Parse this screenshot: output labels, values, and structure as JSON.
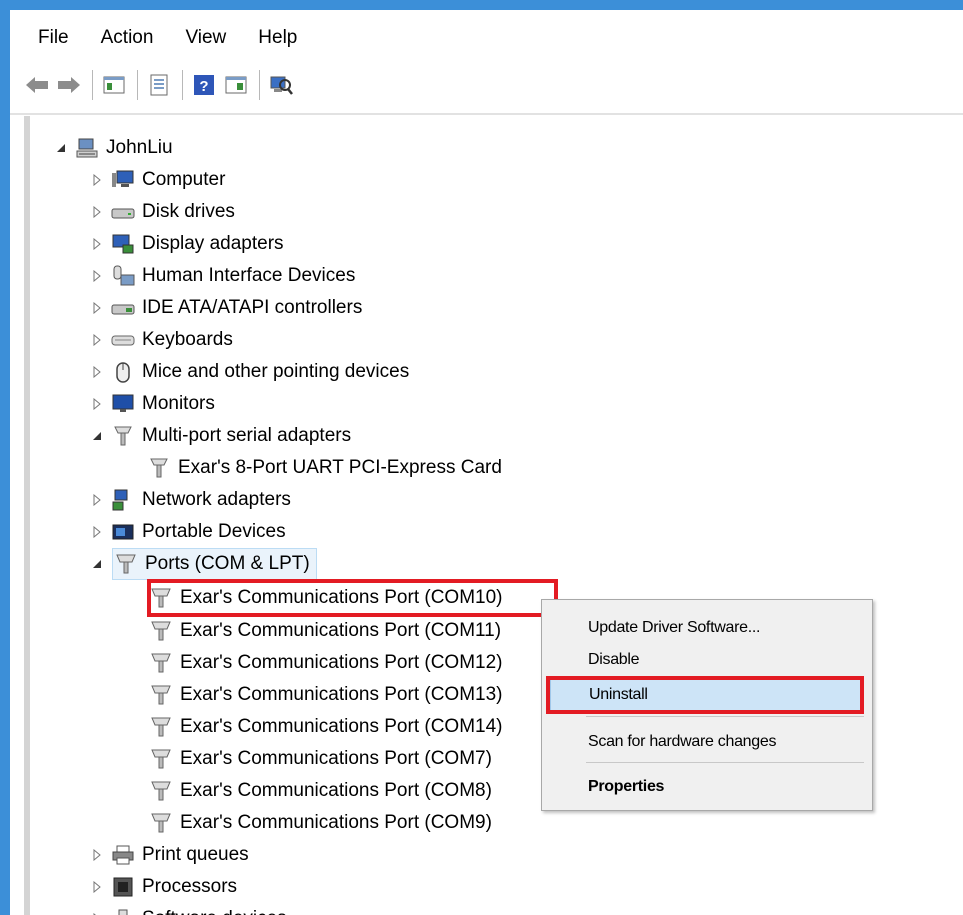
{
  "menu": [
    "File",
    "Action",
    "View",
    "Help"
  ],
  "toolbar": {
    "buttons": [
      "back-arrow-icon",
      "forward-arrow-icon",
      "console-tree-icon",
      "properties-sheet-icon",
      "help-icon",
      "action-pane-icon",
      "scan-hardware-icon"
    ]
  },
  "tree": {
    "root": "JohnLiu",
    "categories": [
      {
        "label": "Computer",
        "icon": "computer-icon",
        "state": "collapsed"
      },
      {
        "label": "Disk drives",
        "icon": "disk-drive-icon",
        "state": "collapsed"
      },
      {
        "label": "Display adapters",
        "icon": "display-adapter-icon",
        "state": "collapsed"
      },
      {
        "label": "Human Interface Devices",
        "icon": "hid-icon",
        "state": "collapsed"
      },
      {
        "label": "IDE ATA/ATAPI controllers",
        "icon": "ide-controller-icon",
        "state": "collapsed"
      },
      {
        "label": "Keyboards",
        "icon": "keyboard-icon",
        "state": "collapsed"
      },
      {
        "label": "Mice and other pointing devices",
        "icon": "mouse-icon",
        "state": "collapsed"
      },
      {
        "label": "Monitors",
        "icon": "monitor-icon",
        "state": "collapsed"
      },
      {
        "label": "Multi-port serial adapters",
        "icon": "serial-adapter-icon",
        "state": "expanded"
      },
      {
        "label": "Exar's 8-Port UART PCI-Express Card",
        "icon": "serial-adapter-icon",
        "state": "child"
      },
      {
        "label": "Network adapters",
        "icon": "network-adapter-icon",
        "state": "collapsed"
      },
      {
        "label": "Portable Devices",
        "icon": "portable-device-icon",
        "state": "collapsed"
      },
      {
        "label": "Ports (COM & LPT)",
        "icon": "port-icon",
        "state": "expanded"
      },
      {
        "label": "Exar's Communications Port (COM10)",
        "icon": "port-icon",
        "state": "child"
      },
      {
        "label": "Exar's Communications Port (COM11)",
        "icon": "port-icon",
        "state": "child"
      },
      {
        "label": "Exar's Communications Port (COM12)",
        "icon": "port-icon",
        "state": "child"
      },
      {
        "label": "Exar's Communications Port (COM13)",
        "icon": "port-icon",
        "state": "child"
      },
      {
        "label": "Exar's Communications Port (COM14)",
        "icon": "port-icon",
        "state": "child"
      },
      {
        "label": "Exar's Communications Port (COM7)",
        "icon": "port-icon",
        "state": "child"
      },
      {
        "label": "Exar's Communications Port (COM8)",
        "icon": "port-icon",
        "state": "child"
      },
      {
        "label": "Exar's Communications Port (COM9)",
        "icon": "port-icon",
        "state": "child"
      },
      {
        "label": "Print queues",
        "icon": "printer-icon",
        "state": "collapsed"
      },
      {
        "label": "Processors",
        "icon": "processor-icon",
        "state": "collapsed"
      },
      {
        "label": "Software devices",
        "icon": "software-device-icon",
        "state": "collapsed"
      }
    ]
  },
  "context_menu": {
    "items": [
      {
        "label": "Update Driver Software...",
        "style": "normal"
      },
      {
        "label": "Disable",
        "style": "normal"
      },
      {
        "label": "Uninstall",
        "style": "active"
      },
      {
        "label": "Scan for hardware changes",
        "style": "normal"
      },
      {
        "label": "Properties",
        "style": "bold"
      }
    ]
  },
  "colors": {
    "window_frame": "#3c8fd8",
    "highlight_box": "#e31b23",
    "menu_hover": "#cde4f7"
  }
}
